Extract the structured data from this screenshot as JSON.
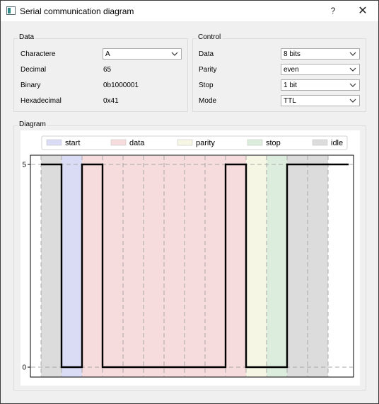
{
  "window": {
    "title": "Serial communication diagram",
    "help": "?",
    "close": "✕"
  },
  "data_group": {
    "title": "Data",
    "rows": [
      {
        "label": "Charactere",
        "value": "A",
        "combo": true
      },
      {
        "label": "Decimal",
        "value": "65"
      },
      {
        "label": "Binary",
        "value": "0b1000001"
      },
      {
        "label": "Hexadecimal",
        "value": "0x41"
      }
    ]
  },
  "control_group": {
    "title": "Control",
    "rows": [
      {
        "label": "Data",
        "value": "8 bits"
      },
      {
        "label": "Parity",
        "value": "even"
      },
      {
        "label": "Stop",
        "value": "1 bit"
      },
      {
        "label": "Mode",
        "value": "TTL"
      }
    ]
  },
  "diagram_group": {
    "title": "Diagram"
  },
  "colors": {
    "start": "#dadcf6",
    "data": "#f7dcdd",
    "parity": "#f6f6e4",
    "stop": "#dceddd",
    "idle": "#dcdcdc",
    "line": "#000000"
  },
  "chart_data": {
    "type": "line",
    "legend": [
      "start",
      "data",
      "parity",
      "stop",
      "idle"
    ],
    "legend_position": "top",
    "yticks": [
      "5",
      "0"
    ],
    "ylim": [
      0,
      5
    ],
    "grid": true,
    "regions": [
      "idle",
      "start",
      "data",
      "data",
      "data",
      "data",
      "data",
      "data",
      "data",
      "data",
      "parity",
      "stop",
      "idle",
      "idle"
    ],
    "levels": [
      5,
      0,
      5,
      0,
      0,
      0,
      0,
      0,
      0,
      5,
      0,
      0,
      5,
      5,
      5
    ]
  }
}
